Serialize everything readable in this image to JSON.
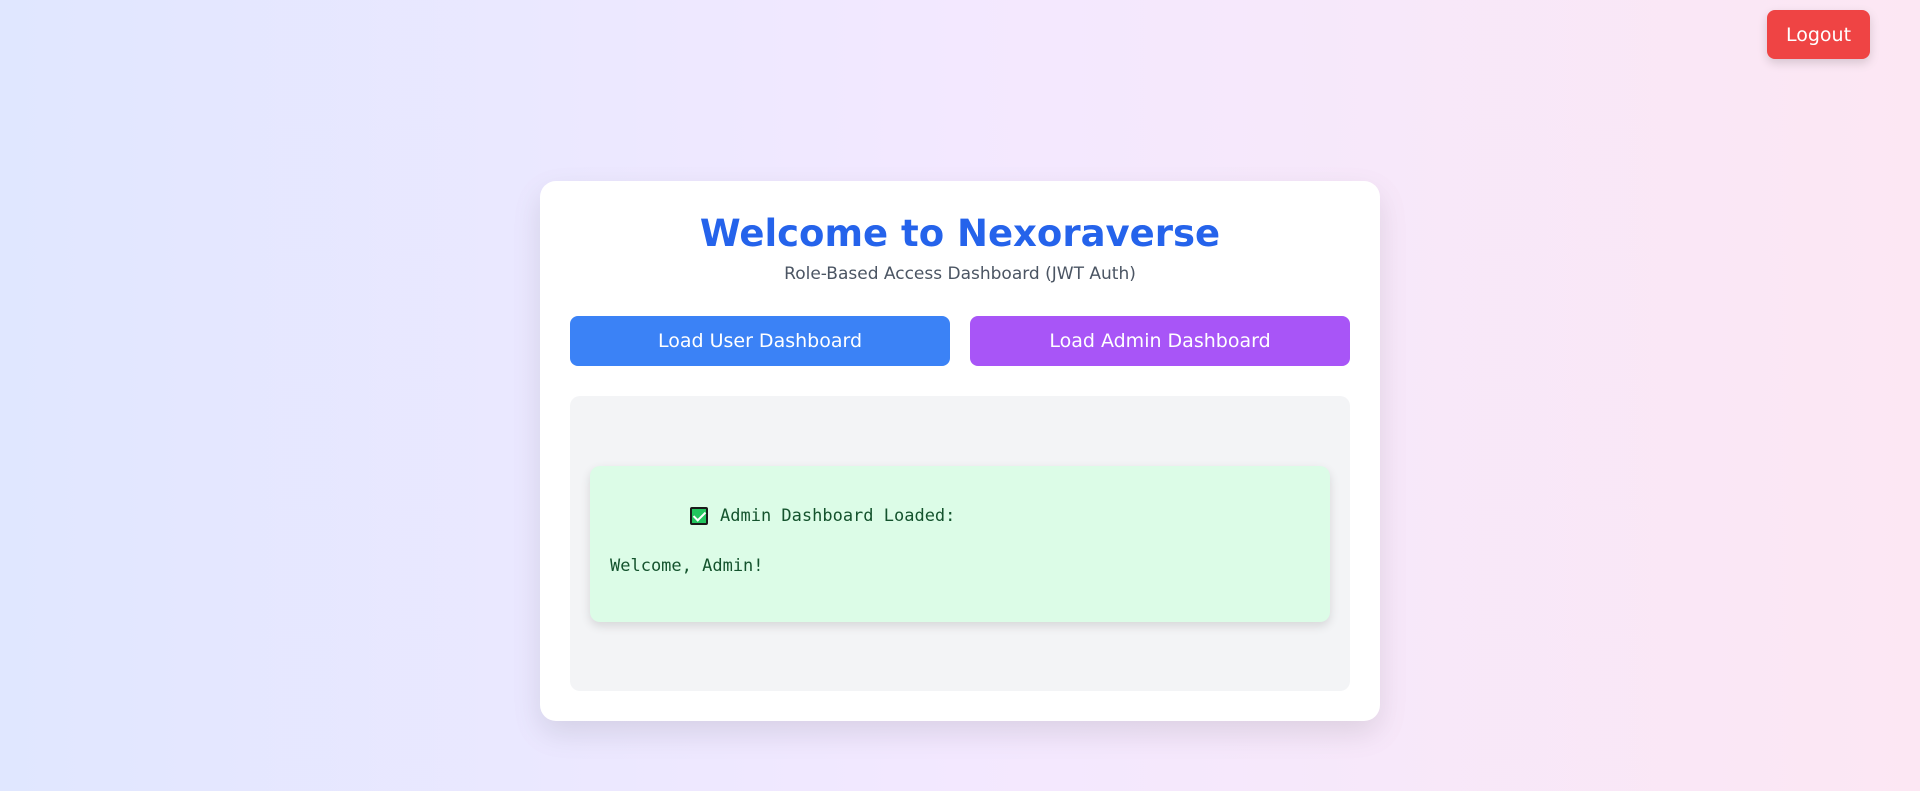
{
  "header": {
    "logout_label": "Logout"
  },
  "card": {
    "title": "Welcome to Nexoraverse",
    "subtitle": "Role-Based Access Dashboard (JWT Auth)",
    "buttons": {
      "user_label": "Load User Dashboard",
      "admin_label": "Load Admin Dashboard"
    },
    "result": {
      "icon": "check-mark-icon",
      "heading": "Admin Dashboard Loaded:",
      "message": "Welcome, Admin!"
    }
  },
  "colors": {
    "title": "#2563eb",
    "user_button": "#3b82f6",
    "admin_button": "#a855f7",
    "logout_button": "#ef4444",
    "result_background": "#dcfce7"
  }
}
